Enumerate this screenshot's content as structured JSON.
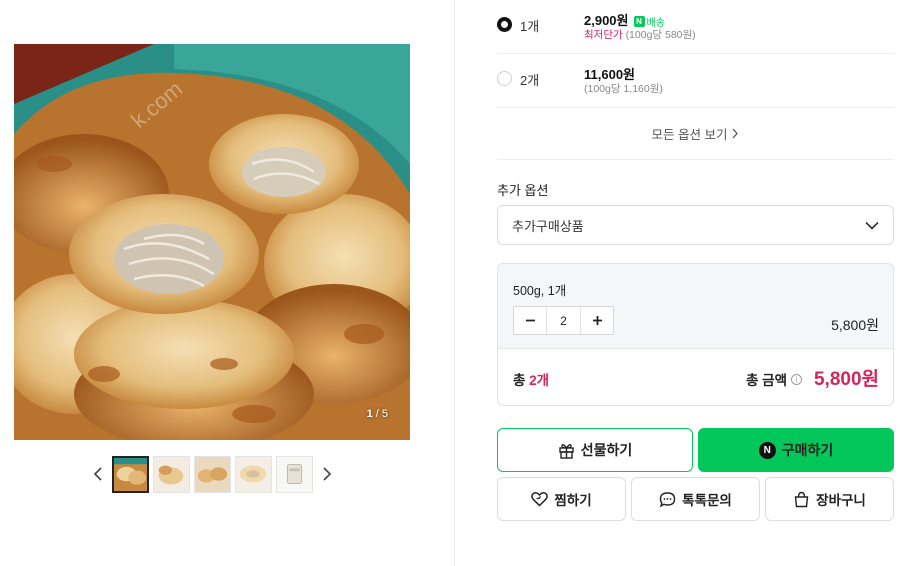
{
  "gallery": {
    "page_current": "1",
    "page_sep": " / ",
    "page_total": "5",
    "prev_icon": "chevron-left-icon",
    "next_icon": "chevron-right-icon",
    "thumbnail_count": 5
  },
  "options": [
    {
      "qty": "1개",
      "price": "2,900원",
      "selected": true,
      "badge": "배송",
      "lowest_label": "최저단가",
      "unit_price": "(100g당 580원)"
    },
    {
      "qty": "2개",
      "price": "11,600원",
      "selected": false,
      "unit_price": "(100g당 1,160원)"
    }
  ],
  "more_options": "모든 옵션 보기",
  "addon": {
    "label": "추가 옵션",
    "select_value": "추가구매상품"
  },
  "cart": {
    "item_name": "500g, 1개",
    "quantity": "2",
    "item_price": "5,800원",
    "total_prefix": "총 ",
    "total_count": "2개",
    "total_label": "총 금액",
    "total_price": "5,800원"
  },
  "buttons": {
    "gift": "선물하기",
    "buy": "구매하기",
    "wish": "찜하기",
    "talk": "톡톡문의",
    "cart": "장바구니"
  },
  "colors": {
    "naver_green": "#03c75a",
    "accent_red": "#d4245c"
  }
}
